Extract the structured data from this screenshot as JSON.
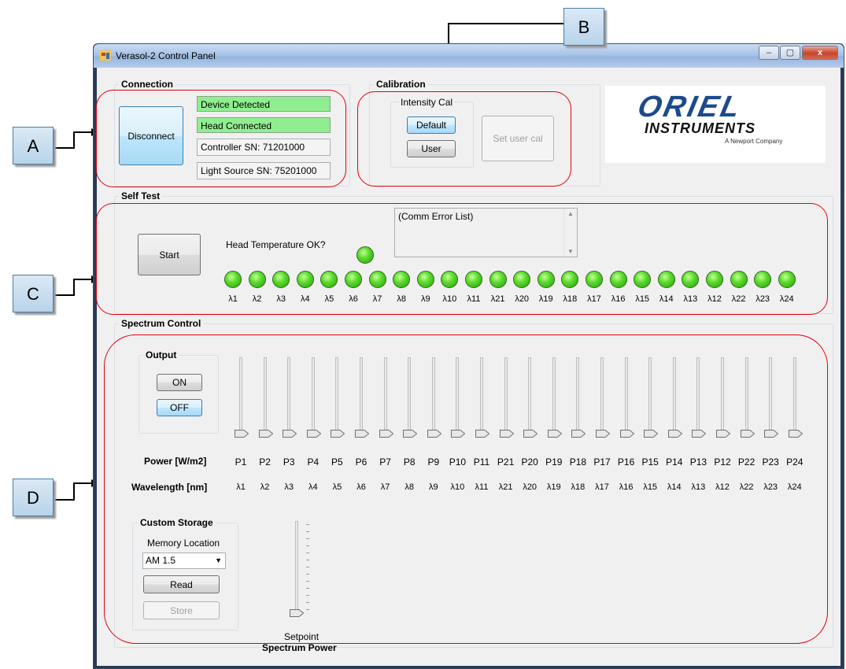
{
  "window": {
    "title": "Verasol-2 Control Panel",
    "min": "–",
    "max": "▢",
    "close": "x"
  },
  "connection": {
    "title": "Connection",
    "disconnect": "Disconnect",
    "device_status": "Device Detected",
    "head_status": "Head Connected",
    "controller_sn": "Controller SN:   71201000",
    "light_source_sn": "Light Source SN: 75201000"
  },
  "calibration": {
    "title": "Calibration",
    "intensity_cal": "Intensity Cal",
    "default": "Default",
    "user": "User",
    "set_user_cal": "Set user cal"
  },
  "logo": {
    "line1": "ORIEL",
    "line2": "INSTRUMENTS",
    "line3": "A Newport Company"
  },
  "self_test": {
    "title": "Self Test",
    "start": "Start",
    "head_temp": "Head Temperature OK?",
    "comm_errors": "(Comm Error List)",
    "leds": [
      "λ1",
      "λ2",
      "λ3",
      "λ4",
      "λ5",
      "λ6",
      "λ7",
      "λ8",
      "λ9",
      "λ10",
      "λ11",
      "λ21",
      "λ20",
      "λ19",
      "λ18",
      "λ17",
      "λ16",
      "λ15",
      "λ14",
      "λ13",
      "λ12",
      "λ22",
      "λ23",
      "λ24"
    ]
  },
  "spectrum": {
    "title": "Spectrum Control",
    "output_title": "Output",
    "on": "ON",
    "off": "OFF",
    "power_label": "Power [W/m2]",
    "wavelength_label": "Wavelength [nm]",
    "powers": [
      "P1",
      "P2",
      "P3",
      "P4",
      "P5",
      "P6",
      "P7",
      "P8",
      "P9",
      "P10",
      "P11",
      "P21",
      "P20",
      "P19",
      "P18",
      "P17",
      "P16",
      "P15",
      "P14",
      "P13",
      "P12",
      "P22",
      "P23",
      "P24"
    ],
    "wavelengths": [
      "λ1",
      "λ2",
      "λ3",
      "λ4",
      "λ5",
      "λ6",
      "λ7",
      "λ8",
      "λ9",
      "λ10",
      "λ11",
      "λ21",
      "λ20",
      "λ19",
      "λ18",
      "λ17",
      "λ16",
      "λ15",
      "λ14",
      "λ13",
      "λ12",
      "λ22",
      "λ23",
      "λ24"
    ],
    "storage_title": "Custom Storage",
    "memory_location": "Memory Location",
    "memory_value": "AM 1.5",
    "read": "Read",
    "store": "Store",
    "setpoint": "Setpoint",
    "spectrum_power": "Spectrum Power"
  },
  "callouts": {
    "a": "A",
    "b": "B",
    "c": "C",
    "d": "D"
  },
  "colors": {
    "status_green": "#90ee90",
    "annotation_red": "#e3000f",
    "led_green": "#5bdc2c",
    "logo_blue": "#1c4a8c"
  }
}
